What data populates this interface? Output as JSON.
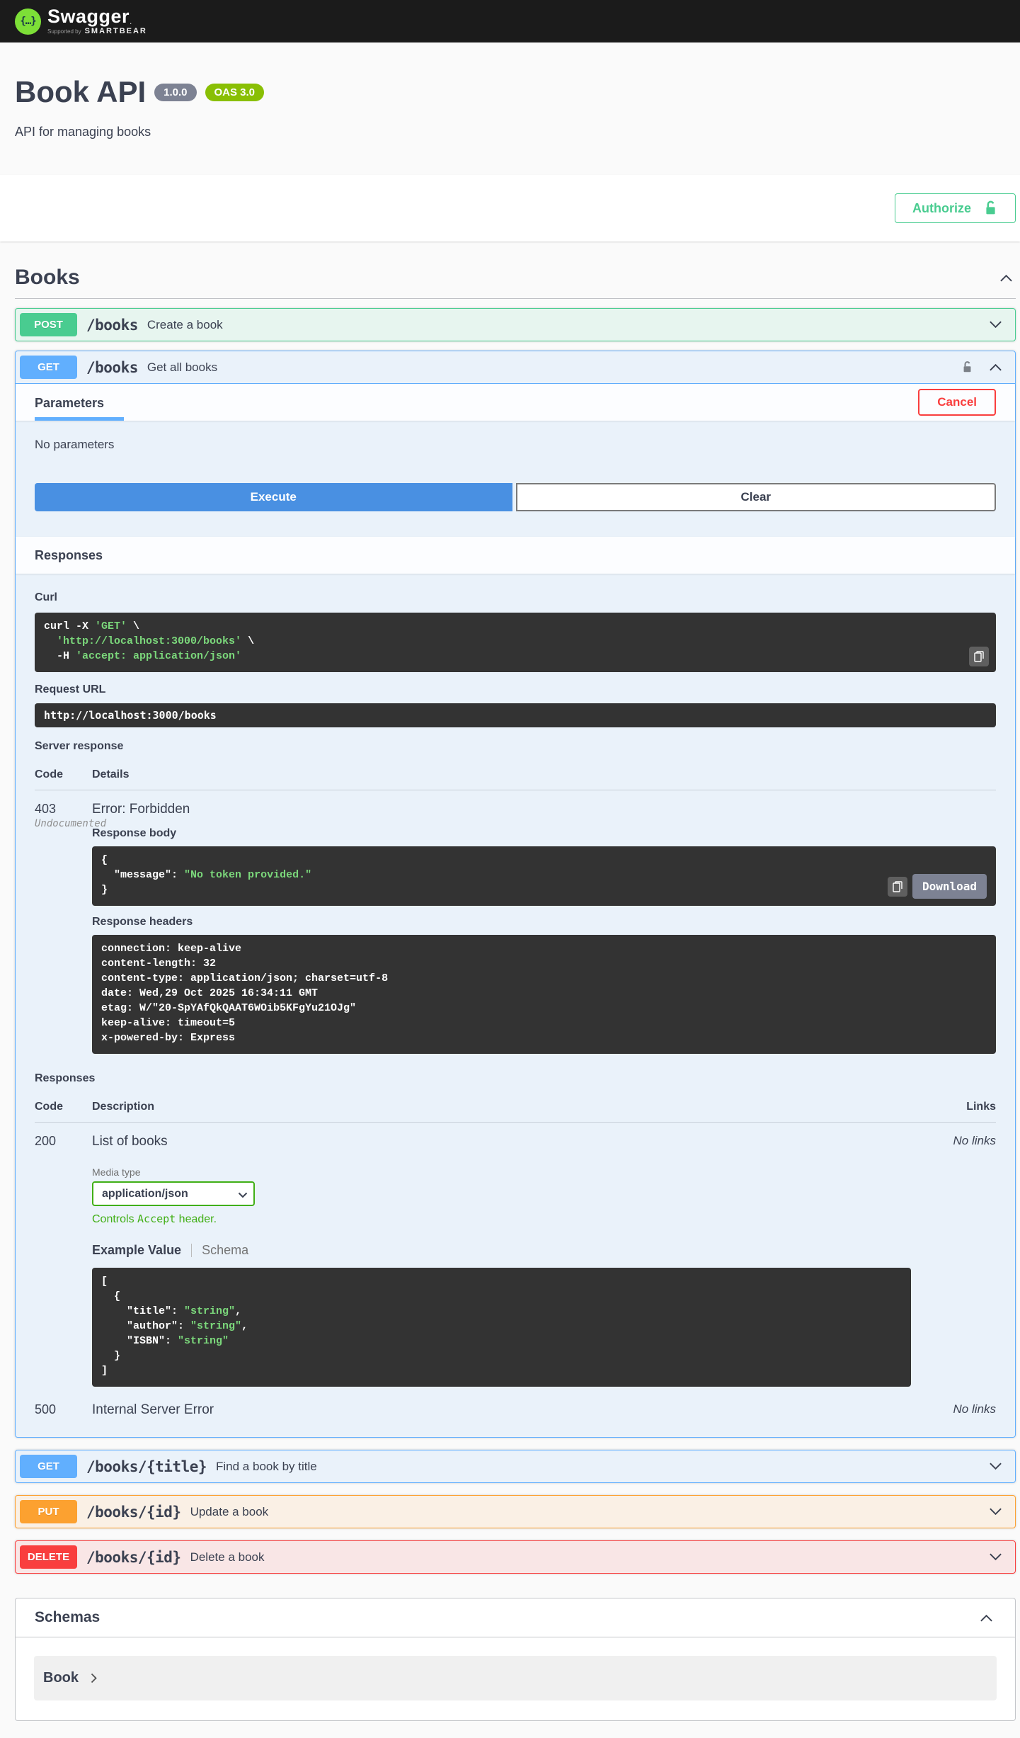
{
  "colors": {
    "topbar_bg": "#1b1b1b",
    "logo_green": "#7ddf37",
    "get": "#61affe",
    "post": "#49cc90",
    "put": "#fca130",
    "delete": "#f93e3e",
    "authorize_green": "#49cc90",
    "execute_blue": "#4990e2",
    "cancel_red": "#f93e3e",
    "version_badge_gray": "#7d8293",
    "oas_badge_green": "#89bf04",
    "code_block_bg": "#333333",
    "code_string_green": "#7bd77b",
    "media_type_green": "#41af16",
    "download_gray": "#7d8293"
  },
  "topbar": {
    "brand": "Swagger",
    "brand_mark": ".",
    "supported_by": "Supported by",
    "sponsor": "SMARTBEAR",
    "logo_glyph": "{…}"
  },
  "info": {
    "title": "Book API",
    "version": "1.0.0",
    "spec_badge": "OAS 3.0",
    "description": "API for managing books"
  },
  "auth": {
    "authorize_label": "Authorize"
  },
  "tag": {
    "title": "Books"
  },
  "operations": {
    "post_books": {
      "method": "POST",
      "path": "/books",
      "summary": "Create a book"
    },
    "get_books": {
      "method": "GET",
      "path": "/books",
      "summary": "Get all books"
    },
    "get_book_by_title": {
      "method": "GET",
      "path": "/books/{title}",
      "summary": "Find a book by title"
    },
    "put_book": {
      "method": "PUT",
      "path": "/books/{id}",
      "summary": "Update a book"
    },
    "delete_book": {
      "method": "DELETE",
      "path": "/books/{id}",
      "summary": "Delete a book"
    }
  },
  "panel": {
    "parameters_tab": "Parameters",
    "cancel": "Cancel",
    "no_parameters": "No parameters",
    "execute": "Execute",
    "clear": "Clear",
    "responses_title": "Responses",
    "curl_label": "Curl",
    "request_url_label": "Request URL",
    "request_url": "http://localhost:3000/books",
    "server_response_label": "Server response",
    "headers": {
      "code": "Code",
      "details": "Details",
      "description": "Description",
      "links": "Links"
    },
    "server_response": {
      "code": "403",
      "undocumented": "Undocumented",
      "description": "Error: Forbidden",
      "response_body_label": "Response body",
      "download": "Download",
      "response_headers_label": "Response headers"
    },
    "responses_label": "Responses",
    "media_type_label": "Media type",
    "media_type": "application/json",
    "accept_note_parts": [
      "Controls ",
      "Accept",
      " header."
    ],
    "tabs": {
      "example": "Example Value",
      "schema": "Schema"
    },
    "responses": [
      {
        "code": "200",
        "description": "List of books",
        "links": "No links"
      },
      {
        "code": "500",
        "description": "Internal Server Error",
        "links": "No links"
      }
    ]
  },
  "code_blocks": {
    "curl": [
      [
        [
          "p",
          "curl -X "
        ],
        [
          "s",
          "'GET'"
        ],
        [
          "p",
          " \\"
        ]
      ],
      [
        [
          "p",
          "  "
        ],
        [
          "s",
          "'http://localhost:3000/books'"
        ],
        [
          "p",
          " \\"
        ]
      ],
      [
        [
          "p",
          "  -H "
        ],
        [
          "s",
          "'accept: application/json'"
        ]
      ]
    ],
    "response_body": [
      [
        [
          "p",
          "{"
        ]
      ],
      [
        [
          "p",
          "  "
        ],
        [
          "k",
          "\"message\""
        ],
        [
          "p",
          ": "
        ],
        [
          "s",
          "\"No token provided.\""
        ]
      ],
      [
        [
          "p",
          "}"
        ]
      ]
    ],
    "response_headers": [
      [
        [
          "p",
          "connection: keep-alive"
        ]
      ],
      [
        [
          "p",
          "content-length: 32"
        ]
      ],
      [
        [
          "p",
          "content-type: application/json; charset=utf-8"
        ]
      ],
      [
        [
          "p",
          "date: Wed,29 Oct 2025 16:34:11 GMT"
        ]
      ],
      [
        [
          "p",
          "etag: W/\"20-SpYAfQkQAAT6WOib5KFgYu21OJg\""
        ]
      ],
      [
        [
          "p",
          "keep-alive: timeout=5"
        ]
      ],
      [
        [
          "p",
          "x-powered-by: Express"
        ]
      ]
    ],
    "example": [
      [
        [
          "p",
          "["
        ]
      ],
      [
        [
          "p",
          "  {"
        ]
      ],
      [
        [
          "p",
          "    "
        ],
        [
          "k",
          "\"title\""
        ],
        [
          "p",
          ": "
        ],
        [
          "s",
          "\"string\""
        ],
        [
          "p",
          ","
        ]
      ],
      [
        [
          "p",
          "    "
        ],
        [
          "k",
          "\"author\""
        ],
        [
          "p",
          ": "
        ],
        [
          "s",
          "\"string\""
        ],
        [
          "p",
          ","
        ]
      ],
      [
        [
          "p",
          "    "
        ],
        [
          "k",
          "\"ISBN\""
        ],
        [
          "p",
          ": "
        ],
        [
          "s",
          "\"string\""
        ]
      ],
      [
        [
          "p",
          "  }"
        ]
      ],
      [
        [
          "p",
          "]"
        ]
      ]
    ]
  },
  "schemas": {
    "title": "Schemas",
    "model": "Book"
  }
}
